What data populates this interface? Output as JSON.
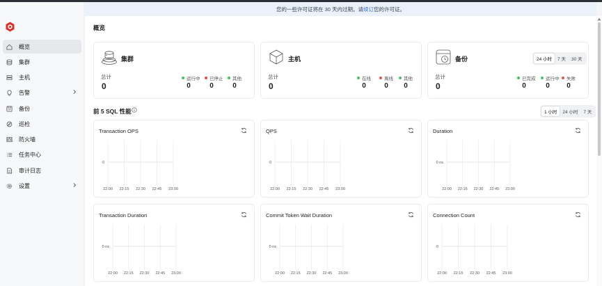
{
  "banner": {
    "text_before": "您的一些许可证将在 30 天内过期。请",
    "link": "续订",
    "text_after": "您的许可证。"
  },
  "sidebar": {
    "items": [
      {
        "label": "概览",
        "icon": "home-icon",
        "active": true
      },
      {
        "label": "集群",
        "icon": "database-icon"
      },
      {
        "label": "主机",
        "icon": "server-icon"
      },
      {
        "label": "告警",
        "icon": "bulb-icon",
        "chevron": true
      },
      {
        "label": "备份",
        "icon": "save-icon"
      },
      {
        "label": "巡检",
        "icon": "compass-icon"
      },
      {
        "label": "防火墙",
        "icon": "firewall-icon"
      },
      {
        "label": "任务中心",
        "icon": "list-icon"
      },
      {
        "label": "审计日志",
        "icon": "document-icon"
      },
      {
        "label": "设置",
        "icon": "gear-icon",
        "chevron": true
      }
    ]
  },
  "overview": {
    "title": "概览",
    "cards": [
      {
        "title": "集群",
        "icon": "cluster-icon",
        "total_label": "总计",
        "total": "0",
        "stats": [
          {
            "label": "运行中",
            "color": "#3fbf6c",
            "value": "0"
          },
          {
            "label": "已停止",
            "color": "#e5534b",
            "value": "0"
          },
          {
            "label": "其他",
            "color": "#3fbf6c",
            "value": "0"
          }
        ]
      },
      {
        "title": "主机",
        "icon": "cube-icon",
        "total_label": "总计",
        "total": "0",
        "stats": [
          {
            "label": "在线",
            "color": "#3fbf6c",
            "value": "0"
          },
          {
            "label": "离线",
            "color": "#e5534b",
            "value": "0"
          },
          {
            "label": "其他",
            "color": "#3fbf6c",
            "value": "0"
          }
        ]
      },
      {
        "title": "备份",
        "icon": "backup-icon",
        "total_label": "总计",
        "total": "0",
        "stats": [
          {
            "label": "已完成",
            "color": "#3fbf6c",
            "value": "0"
          },
          {
            "label": "运行中",
            "color": "#3fbf6c",
            "value": "0"
          },
          {
            "label": "失败",
            "color": "#e5534b",
            "value": "0"
          }
        ],
        "ranges": [
          "24 小时",
          "7 天",
          "30 天"
        ],
        "selected": "24 小时"
      }
    ]
  },
  "sql": {
    "title": "前 5 SQL 性能",
    "ranges": [
      "1 小时",
      "24 小时",
      "7 天"
    ],
    "selected": "1 小时"
  },
  "chart_data": [
    {
      "type": "line",
      "title": "Transaction OPS",
      "x": [
        "22:00",
        "22:15",
        "22:30",
        "22:45",
        "23:00"
      ],
      "y_ticks": [
        "0"
      ],
      "series": []
    },
    {
      "type": "line",
      "title": "QPS",
      "x": [
        "22:00",
        "22:15",
        "22:30",
        "22:45",
        "23:00"
      ],
      "y_ticks": [
        "0"
      ],
      "series": []
    },
    {
      "type": "line",
      "title": "Duration",
      "x": [
        "22:00",
        "22:15",
        "22:30",
        "22:45",
        "23:00"
      ],
      "y_ticks": [
        "0 ns"
      ],
      "series": []
    },
    {
      "type": "line",
      "title": "Transaction Duration",
      "x": [
        "22:00",
        "22:15",
        "22:30",
        "22:45",
        "23:00"
      ],
      "y_ticks": [
        "0 ns"
      ],
      "series": []
    },
    {
      "type": "line",
      "title": "Commit Token Wait Duration",
      "x": [
        "22:00",
        "22:15",
        "22:30",
        "22:45",
        "23:00"
      ],
      "y_ticks": [
        "0 ns"
      ],
      "series": []
    },
    {
      "type": "line",
      "title": "Connection Count",
      "x": [
        "22:00",
        "22:15",
        "22:30",
        "22:45",
        "23:00"
      ],
      "y_ticks": [
        "0"
      ],
      "series": []
    }
  ]
}
